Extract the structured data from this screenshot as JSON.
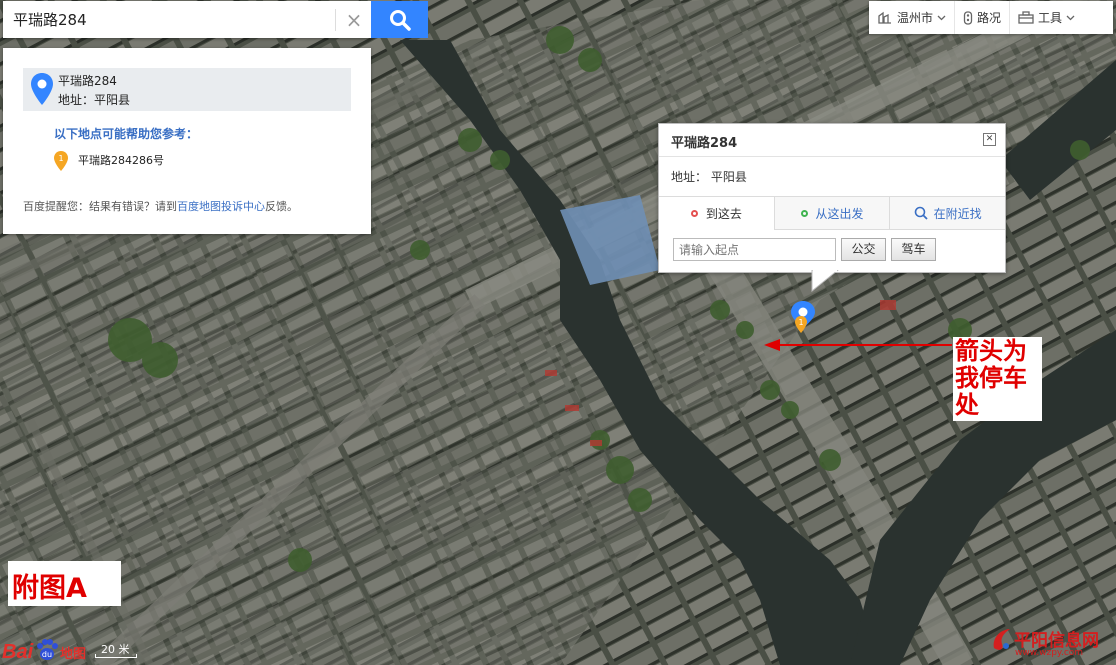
{
  "search": {
    "value": "平瑞路284",
    "clear_icon": "close-icon",
    "search_icon": "search-icon"
  },
  "toolbar": {
    "city": "温州市",
    "traffic": "路况",
    "tools": "工具"
  },
  "panel": {
    "result_title": "平瑞路284",
    "result_address": "地址：平阳县",
    "suggest_heading": "以下地点可能帮助您参考：",
    "suggest_item": "平瑞路284286号",
    "suggest_item_marker": "1",
    "feedback_prefix": "百度提醒您：结果有错误？请到",
    "feedback_link": "百度地图投诉中心",
    "feedback_suffix": "反馈。"
  },
  "popup": {
    "title": "平瑞路284",
    "address": "地址：  平阳县",
    "tab_to": "到这去",
    "tab_from": "从这出发",
    "tab_nearby": "在附近找",
    "start_placeholder": "请输入起点",
    "bus_button": "公交",
    "car_button": "驾车"
  },
  "annotation": {
    "note": "箭头为我停车处",
    "figure_label": "附图A",
    "arrow_color": "#e00000"
  },
  "map": {
    "marker_label": "1",
    "logo_bai": "Bai",
    "logo_du": "du",
    "logo_map": "地图",
    "scale_label": "20 米"
  },
  "watermark": {
    "name": "平阳信息网",
    "url": "www.wzpy.com"
  },
  "colors": {
    "accent": "#3385ff",
    "link": "#3a6fc4",
    "annotation_red": "#e00000",
    "pin_blue": "#3385ff",
    "pin_orange": "#f5a623"
  }
}
